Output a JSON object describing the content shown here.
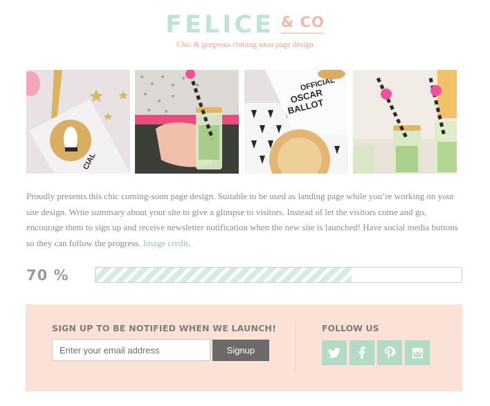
{
  "brand": {
    "name": "FELICE",
    "suffix": "& CO",
    "tagline": "Chic & gorgeous coming soon page design"
  },
  "photos": [
    {
      "icon": "award-tag-photo"
    },
    {
      "icon": "drink-hand-photo"
    },
    {
      "icon": "oscar-ballot-photo"
    },
    {
      "icon": "drinks-straws-photo"
    }
  ],
  "intro": {
    "text": "Proudly presents this chic coming-soon page design. Suitable to be used as landing page while you’re working on your site design. Write summary about your site to give a glimpse to visitors. Instead of let the visitors come and go, encourage them to sign up and receive newsletter notification when the new site is launched! Have social media buttons so they can follow the progress.",
    "credit_link": "Image credit",
    "end": "."
  },
  "progress": {
    "label": "70 %",
    "value": 0.7
  },
  "signup": {
    "title": "SIGN UP TO BE NOTIFIED WHEN WE LAUNCH!",
    "placeholder": "Enter your email address",
    "button": "Signup"
  },
  "follow": {
    "title": "FOLLOW US",
    "icons": [
      "twitter-icon",
      "facebook-icon",
      "pinterest-icon",
      "instagram-icon"
    ]
  },
  "colors": {
    "mint": "#bfe3d6",
    "peach": "#fbe1d6",
    "coral": "#f2b8a8",
    "dark_button": "#6a6a6a"
  }
}
